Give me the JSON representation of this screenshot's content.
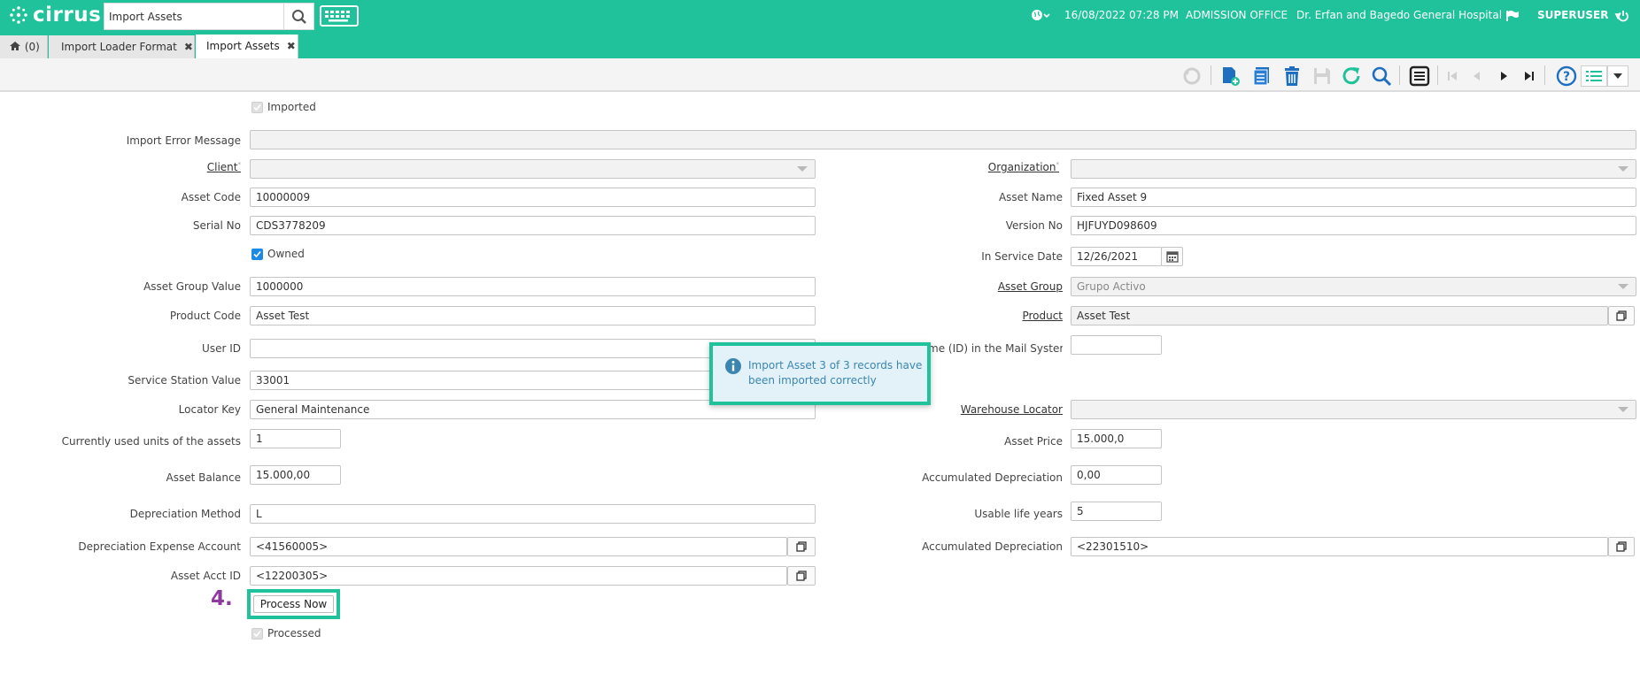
{
  "app": {
    "logo_text": "cirrus",
    "search_value": "Import Assets",
    "datetime": "16/08/2022 07:28 PM",
    "office": "ADMISSION OFFICE",
    "hospital": "Dr. Erfan and Bagedo General Hospital",
    "user": "SUPERUSER",
    "accent": "#1fc29a"
  },
  "tabs": [
    {
      "label": "(0)",
      "icon": "home-icon"
    },
    {
      "label": "Import Loader Format",
      "closable": true
    },
    {
      "label": "Import Assets",
      "closable": true,
      "active": true
    }
  ],
  "toolbar": {
    "icons": [
      "undo-icon",
      "new-record-icon",
      "copy-record-icon",
      "delete-icon",
      "save-icon",
      "refresh-icon",
      "find-icon",
      "grid-toggle-icon",
      "first-record-icon",
      "previous-record-icon",
      "next-record-icon",
      "last-record-icon",
      "help-icon",
      "menu-list-icon",
      "dropdown-icon"
    ]
  },
  "form": {
    "imported_label": "Imported",
    "import_error_label": "Import Error Message",
    "import_error_value": "",
    "client_label": "Client",
    "client_value": "",
    "organization_label": "Organization",
    "organization_value": "",
    "asset_code_label": "Asset Code",
    "asset_code_value": "10000009",
    "asset_name_label": "Asset Name",
    "asset_name_value": "Fixed Asset 9",
    "serial_no_label": "Serial No",
    "serial_no_value": "CDS3778209",
    "version_no_label": "Version No",
    "version_no_value": "HJFUYD098609",
    "owned_label": "Owned",
    "in_service_date_label": "In Service Date",
    "in_service_date_value": "12/26/2021",
    "asset_group_value_label": "Asset Group Value",
    "asset_group_value_value": "1000000",
    "asset_group_label": "Asset Group",
    "asset_group_value": "Grupo Activo",
    "product_code_label": "Product Code",
    "product_code_value": "Asset Test",
    "product_label": "Product",
    "product_value": "Asset Test",
    "user_id_label": "User ID",
    "user_id_value": "",
    "mail_name_label": "me (ID) in the Mail System",
    "mail_name_value": "",
    "service_station_label": "Service Station Value",
    "service_station_value": "33001",
    "locator_key_label": "Locator Key",
    "locator_key_value": "General Maintenance",
    "warehouse_locator_label": "Warehouse Locator",
    "warehouse_locator_value": "",
    "units_used_label": "Currently used units of the assets",
    "units_used_value": "1",
    "asset_price_label": "Asset Price",
    "asset_price_value": "15.000,0",
    "asset_balance_label": "Asset Balance",
    "asset_balance_value": "15.000,00",
    "accum_dep_label": "Accumulated Depreciation",
    "accum_dep_value": "0,00",
    "dep_method_label": "Depreciation Method",
    "dep_method_value": "L",
    "usable_life_label": "Usable life years",
    "usable_life_value": "5",
    "dep_expense_label": "Depreciation Expense Account",
    "dep_expense_value": "<41560005>",
    "accum_dep_acct_label": "Accumulated Depreciation",
    "accum_dep_acct_value": "<22301510>",
    "asset_acct_label": "Asset Acct ID",
    "asset_acct_value": "<12200305>",
    "process_now_label": "Process Now",
    "processed_label": "Processed",
    "step_label": "4."
  },
  "notification": {
    "message": "Import Asset 3 of 3 records have been imported correctly"
  }
}
